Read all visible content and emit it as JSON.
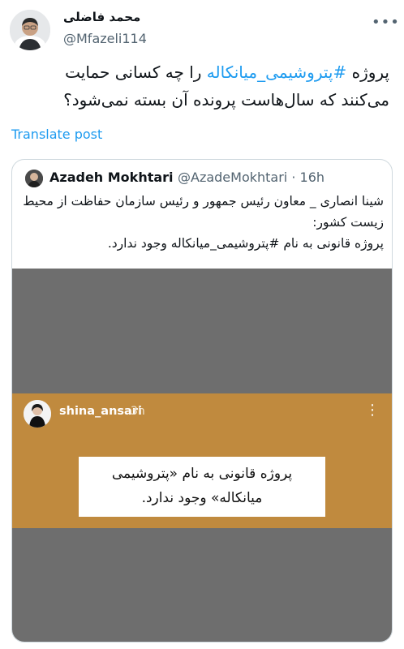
{
  "author": {
    "display_name": "محمد فاضلی",
    "handle": "@Mfazeli114"
  },
  "tweet": {
    "text_before": "پروژه ",
    "hashtag": "#پتروشیمی_میانکاله",
    "text_after": " را چه کسانی حمایت می‌کنند که سال‌هاست پرونده آن بسته نمی‌شود؟"
  },
  "translate_label": "Translate post",
  "quote": {
    "name": "Azadeh Mokhtari",
    "handle": "@AzadeMokhtari",
    "separator": " · ",
    "time": "16h",
    "line1": "شینا انصاری _ معاون رئیس جمهور و رئیس سازمان حفاظت از محیط زیست کشور:",
    "line2_before": "پروژه قانونی به نام ",
    "line2_hashtag": "#پتروشیمی_میانکاله",
    "line2_after": " وجود ندارد."
  },
  "story": {
    "username": "shina_ansari",
    "time": "3h",
    "sticker_text": "پروژه قانونی به نام «پتروشیمی میانکاله» وجود ندارد."
  },
  "icons": {
    "more": "more-horizontal-icon",
    "story_more": "more-vertical-icon"
  },
  "colors": {
    "link": "#1d9bf0",
    "secondary_text": "#536471",
    "story_band": "#c08a3e",
    "media_bg": "#6e6e6e"
  }
}
